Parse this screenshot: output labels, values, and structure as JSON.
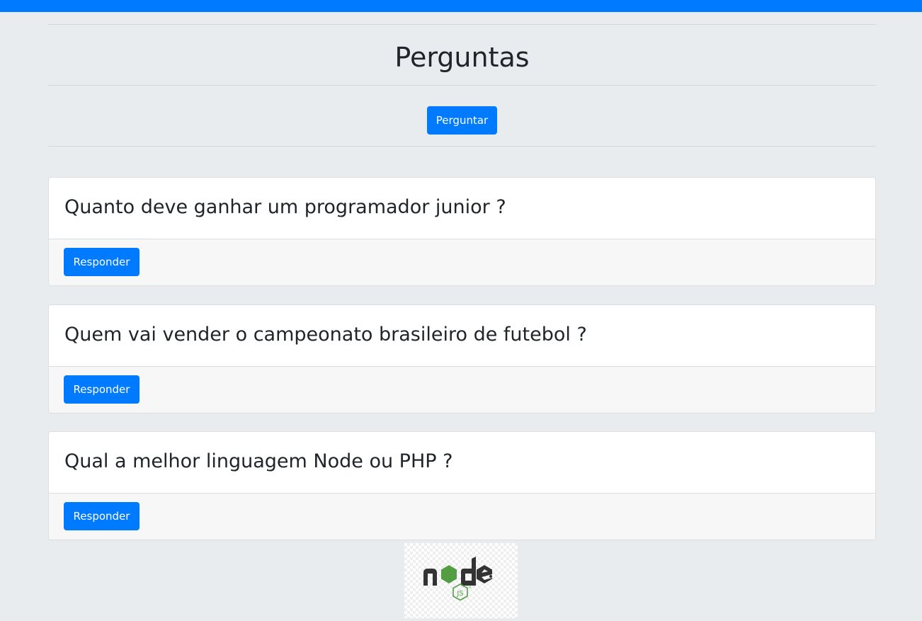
{
  "page": {
    "title": "Perguntas",
    "ask_button": "Perguntar"
  },
  "questions": [
    {
      "title": "Quanto deve ganhar um programador junior ?",
      "answer_label": "Responder"
    },
    {
      "title": "Quem vai vender o campeonato brasileiro de futebol ?",
      "answer_label": "Responder"
    },
    {
      "title": "Qual a melhor linguagem Node ou PHP ?",
      "answer_label": "Responder"
    }
  ],
  "footer_logo": {
    "icon": "nodejs-logo",
    "text": "node",
    "subtext": "JS",
    "colors": {
      "dark": "#333333",
      "green": "#539e43"
    }
  },
  "colors": {
    "accent": "#007bff",
    "background": "#e9ecef"
  }
}
